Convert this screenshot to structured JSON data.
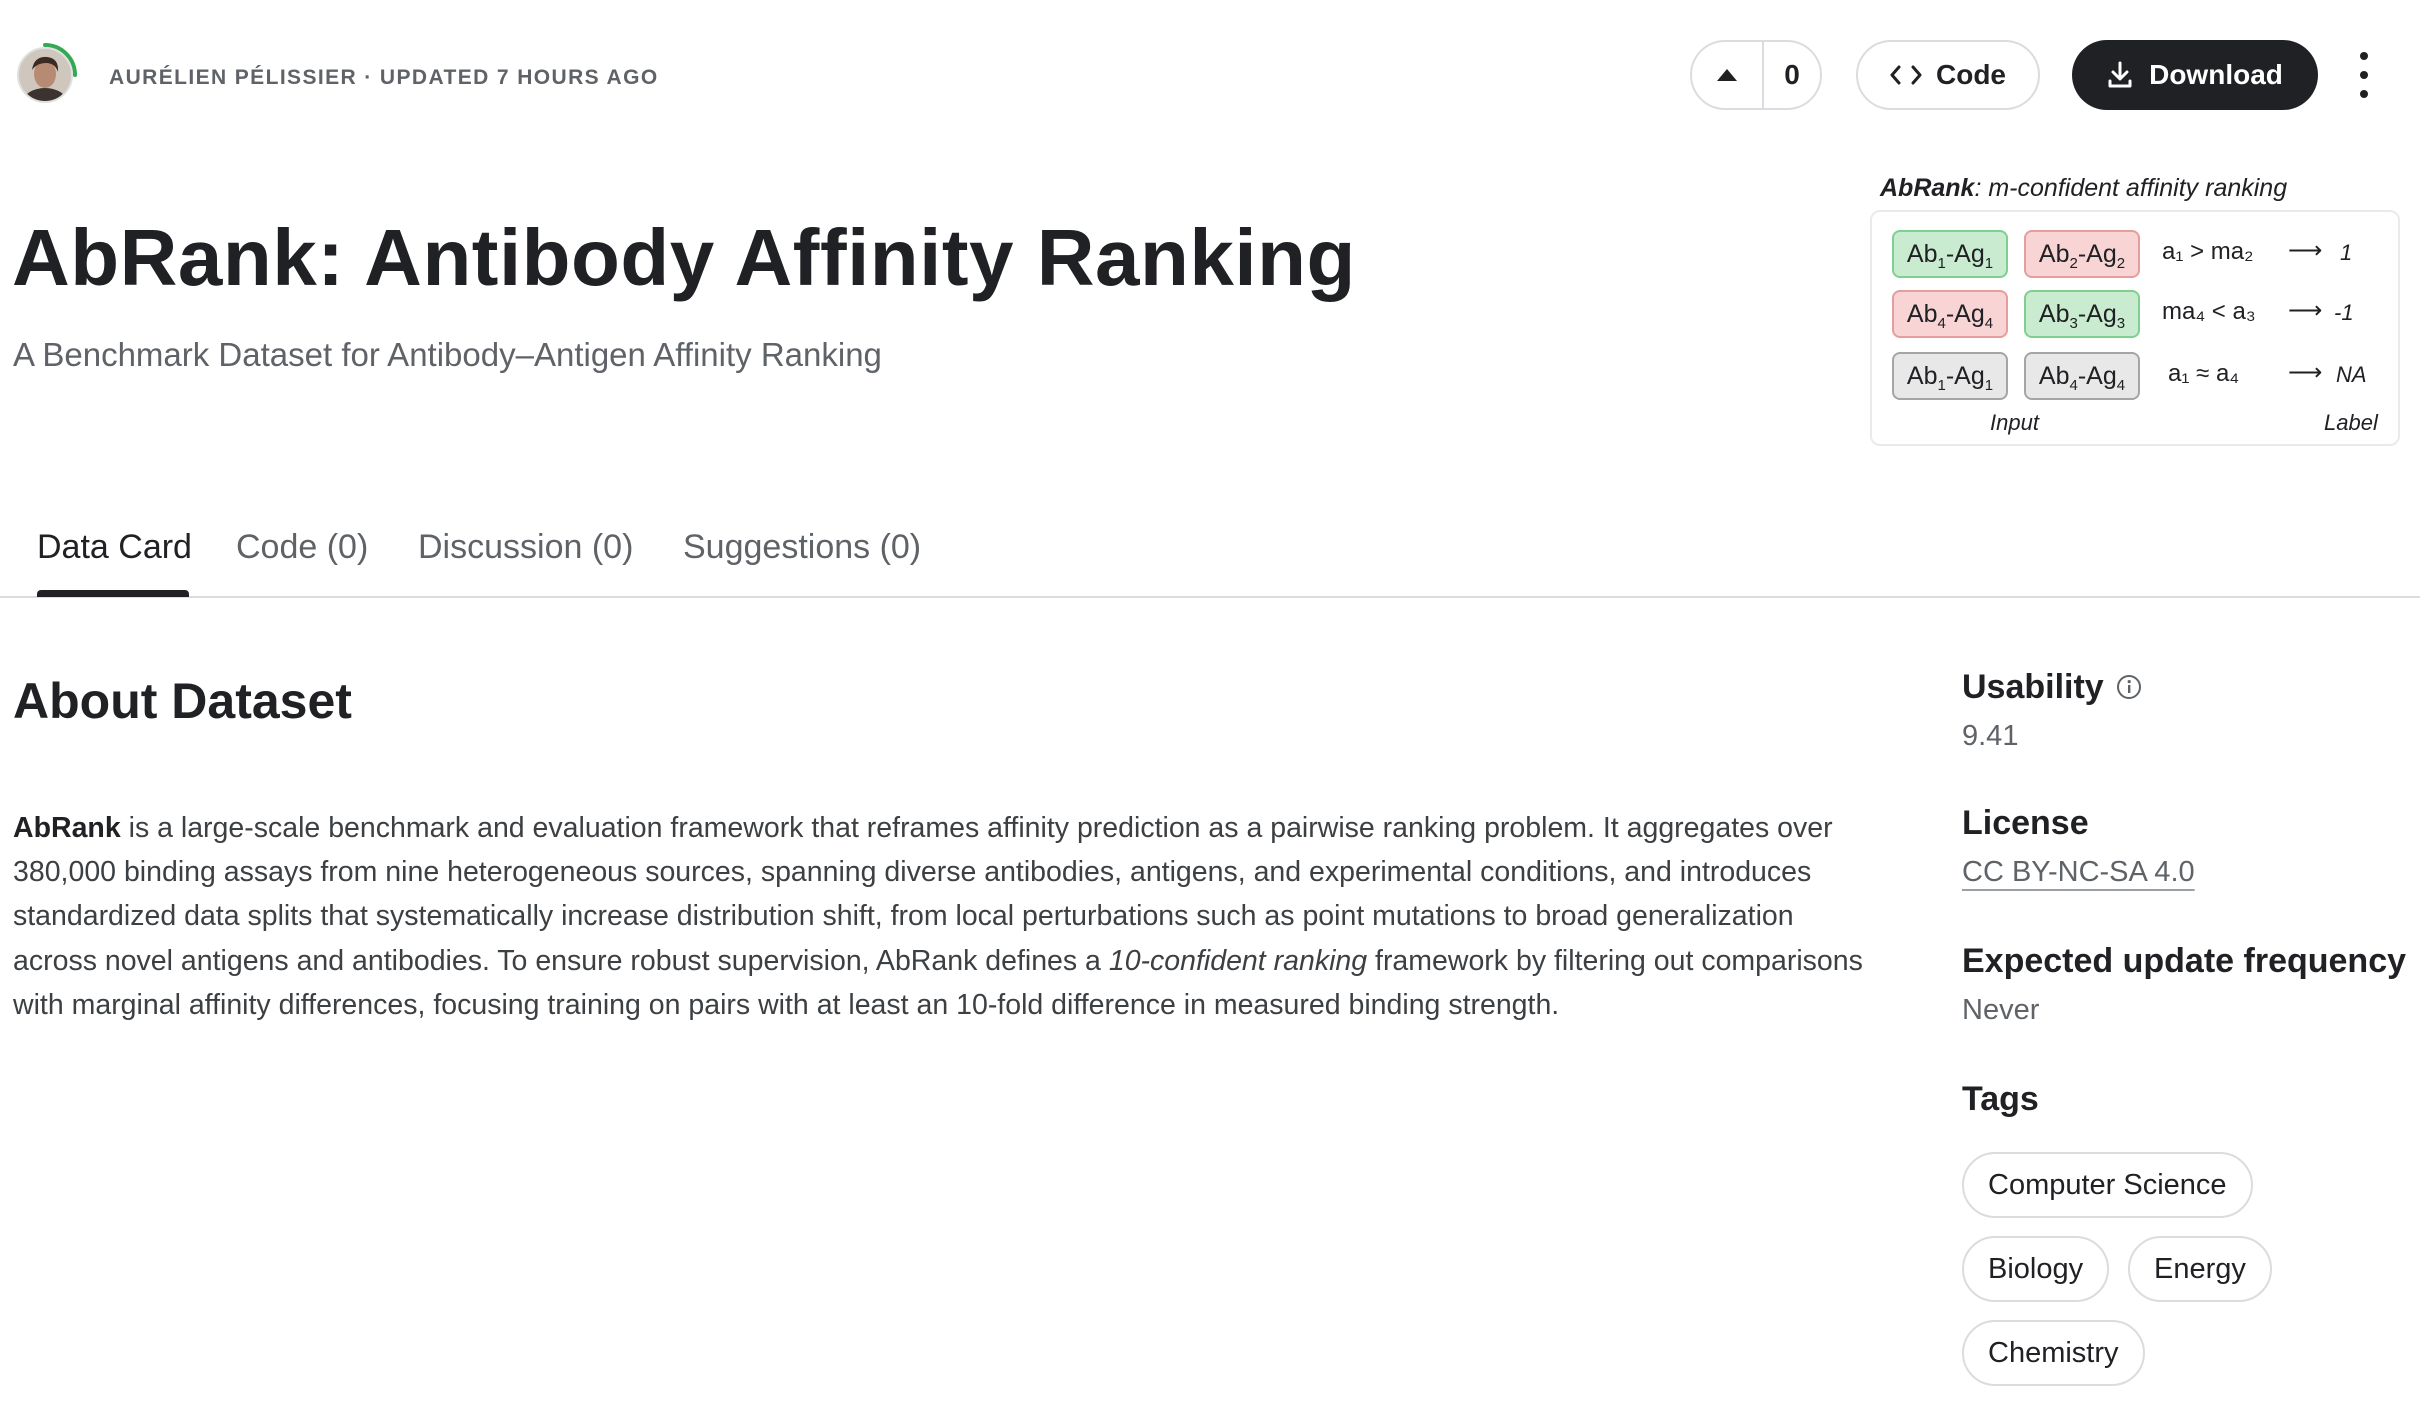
{
  "header": {
    "author_line": "AURÉLIEN PÉLISSIER · UPDATED 7 HOURS AGO",
    "vote_count": "0",
    "code_label": "Code",
    "download_label": "Download"
  },
  "dataset": {
    "title": "AbRank: Antibody Affinity Ranking",
    "subtitle": "A Benchmark Dataset for Antibody–Antigen Affinity Ranking"
  },
  "figure": {
    "caption_bold": "AbRank",
    "caption_rest": ": m-confident affinity ranking",
    "rows": [
      {
        "left": {
          "ab": "1",
          "ag": "1",
          "color": "green"
        },
        "right": {
          "ab": "2",
          "ag": "2",
          "color": "pink"
        },
        "relation": "a₁ > ma₂",
        "label": "1"
      },
      {
        "left": {
          "ab": "4",
          "ag": "4",
          "color": "pink"
        },
        "right": {
          "ab": "3",
          "ag": "3",
          "color": "green"
        },
        "relation": "ma₄ < a₃",
        "label": "-1"
      },
      {
        "left": {
          "ab": "1",
          "ag": "1",
          "color": "grey"
        },
        "right": {
          "ab": "4",
          "ag": "4",
          "color": "grey"
        },
        "relation": "a₁ ≈ a₄",
        "label": "NA"
      }
    ],
    "input_label": "Input",
    "label_label": "Label"
  },
  "tabs": [
    {
      "label": "Data Card",
      "active": true
    },
    {
      "label": "Code (0)",
      "active": false
    },
    {
      "label": "Discussion (0)",
      "active": false
    },
    {
      "label": "Suggestions (0)",
      "active": false
    }
  ],
  "about": {
    "heading": "About Dataset",
    "name_bold": "AbRank",
    "text_1": " is a large-scale benchmark and evaluation framework that reframes affinity prediction as a pairwise ranking problem. It aggregates over 380,000 binding assays from nine heterogeneous sources, spanning diverse antibodies, antigens, and experimental conditions, and introduces standardized data splits that systematically increase distribution shift, from local perturbations such as point mutations to broad generalization across novel antigens and antibodies. To ensure robust supervision, AbRank defines a ",
    "text_italic": "10-confident ranking",
    "text_2": " framework by filtering out comparisons with marginal affinity differences, focusing training on pairs with at least an 10-fold difference in measured binding strength."
  },
  "sidebar": {
    "usability_label": "Usability",
    "usability_value": "9.41",
    "license_label": "License",
    "license_value": "CC BY-NC-SA 4.0",
    "update_label": "Expected update frequency",
    "update_value": "Never",
    "tags_label": "Tags",
    "tags": [
      "Computer Science",
      "Biology",
      "Energy",
      "Chemistry"
    ]
  },
  "colors": {
    "primary_dark": "#202124",
    "muted_text": "#5f6368",
    "border": "#dadce0",
    "chip_green": "#c9ecd1",
    "chip_pink": "#f9d4d4",
    "chip_grey": "#e8e8e8",
    "avatar_ring": "#34a853"
  }
}
